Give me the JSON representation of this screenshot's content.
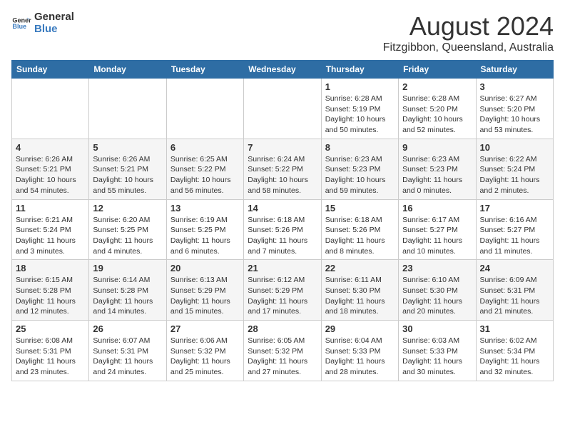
{
  "logo": {
    "general": "General",
    "blue": "Blue"
  },
  "title": "August 2024",
  "subtitle": "Fitzgibbon, Queensland, Australia",
  "days_of_week": [
    "Sunday",
    "Monday",
    "Tuesday",
    "Wednesday",
    "Thursday",
    "Friday",
    "Saturday"
  ],
  "weeks": [
    [
      {
        "day": "",
        "info": ""
      },
      {
        "day": "",
        "info": ""
      },
      {
        "day": "",
        "info": ""
      },
      {
        "day": "",
        "info": ""
      },
      {
        "day": "1",
        "info": "Sunrise: 6:28 AM\nSunset: 5:19 PM\nDaylight: 10 hours\nand 50 minutes."
      },
      {
        "day": "2",
        "info": "Sunrise: 6:28 AM\nSunset: 5:20 PM\nDaylight: 10 hours\nand 52 minutes."
      },
      {
        "day": "3",
        "info": "Sunrise: 6:27 AM\nSunset: 5:20 PM\nDaylight: 10 hours\nand 53 minutes."
      }
    ],
    [
      {
        "day": "4",
        "info": "Sunrise: 6:26 AM\nSunset: 5:21 PM\nDaylight: 10 hours\nand 54 minutes."
      },
      {
        "day": "5",
        "info": "Sunrise: 6:26 AM\nSunset: 5:21 PM\nDaylight: 10 hours\nand 55 minutes."
      },
      {
        "day": "6",
        "info": "Sunrise: 6:25 AM\nSunset: 5:22 PM\nDaylight: 10 hours\nand 56 minutes."
      },
      {
        "day": "7",
        "info": "Sunrise: 6:24 AM\nSunset: 5:22 PM\nDaylight: 10 hours\nand 58 minutes."
      },
      {
        "day": "8",
        "info": "Sunrise: 6:23 AM\nSunset: 5:23 PM\nDaylight: 10 hours\nand 59 minutes."
      },
      {
        "day": "9",
        "info": "Sunrise: 6:23 AM\nSunset: 5:23 PM\nDaylight: 11 hours\nand 0 minutes."
      },
      {
        "day": "10",
        "info": "Sunrise: 6:22 AM\nSunset: 5:24 PM\nDaylight: 11 hours\nand 2 minutes."
      }
    ],
    [
      {
        "day": "11",
        "info": "Sunrise: 6:21 AM\nSunset: 5:24 PM\nDaylight: 11 hours\nand 3 minutes."
      },
      {
        "day": "12",
        "info": "Sunrise: 6:20 AM\nSunset: 5:25 PM\nDaylight: 11 hours\nand 4 minutes."
      },
      {
        "day": "13",
        "info": "Sunrise: 6:19 AM\nSunset: 5:25 PM\nDaylight: 11 hours\nand 6 minutes."
      },
      {
        "day": "14",
        "info": "Sunrise: 6:18 AM\nSunset: 5:26 PM\nDaylight: 11 hours\nand 7 minutes."
      },
      {
        "day": "15",
        "info": "Sunrise: 6:18 AM\nSunset: 5:26 PM\nDaylight: 11 hours\nand 8 minutes."
      },
      {
        "day": "16",
        "info": "Sunrise: 6:17 AM\nSunset: 5:27 PM\nDaylight: 11 hours\nand 10 minutes."
      },
      {
        "day": "17",
        "info": "Sunrise: 6:16 AM\nSunset: 5:27 PM\nDaylight: 11 hours\nand 11 minutes."
      }
    ],
    [
      {
        "day": "18",
        "info": "Sunrise: 6:15 AM\nSunset: 5:28 PM\nDaylight: 11 hours\nand 12 minutes."
      },
      {
        "day": "19",
        "info": "Sunrise: 6:14 AM\nSunset: 5:28 PM\nDaylight: 11 hours\nand 14 minutes."
      },
      {
        "day": "20",
        "info": "Sunrise: 6:13 AM\nSunset: 5:29 PM\nDaylight: 11 hours\nand 15 minutes."
      },
      {
        "day": "21",
        "info": "Sunrise: 6:12 AM\nSunset: 5:29 PM\nDaylight: 11 hours\nand 17 minutes."
      },
      {
        "day": "22",
        "info": "Sunrise: 6:11 AM\nSunset: 5:30 PM\nDaylight: 11 hours\nand 18 minutes."
      },
      {
        "day": "23",
        "info": "Sunrise: 6:10 AM\nSunset: 5:30 PM\nDaylight: 11 hours\nand 20 minutes."
      },
      {
        "day": "24",
        "info": "Sunrise: 6:09 AM\nSunset: 5:31 PM\nDaylight: 11 hours\nand 21 minutes."
      }
    ],
    [
      {
        "day": "25",
        "info": "Sunrise: 6:08 AM\nSunset: 5:31 PM\nDaylight: 11 hours\nand 23 minutes."
      },
      {
        "day": "26",
        "info": "Sunrise: 6:07 AM\nSunset: 5:31 PM\nDaylight: 11 hours\nand 24 minutes."
      },
      {
        "day": "27",
        "info": "Sunrise: 6:06 AM\nSunset: 5:32 PM\nDaylight: 11 hours\nand 25 minutes."
      },
      {
        "day": "28",
        "info": "Sunrise: 6:05 AM\nSunset: 5:32 PM\nDaylight: 11 hours\nand 27 minutes."
      },
      {
        "day": "29",
        "info": "Sunrise: 6:04 AM\nSunset: 5:33 PM\nDaylight: 11 hours\nand 28 minutes."
      },
      {
        "day": "30",
        "info": "Sunrise: 6:03 AM\nSunset: 5:33 PM\nDaylight: 11 hours\nand 30 minutes."
      },
      {
        "day": "31",
        "info": "Sunrise: 6:02 AM\nSunset: 5:34 PM\nDaylight: 11 hours\nand 32 minutes."
      }
    ]
  ]
}
